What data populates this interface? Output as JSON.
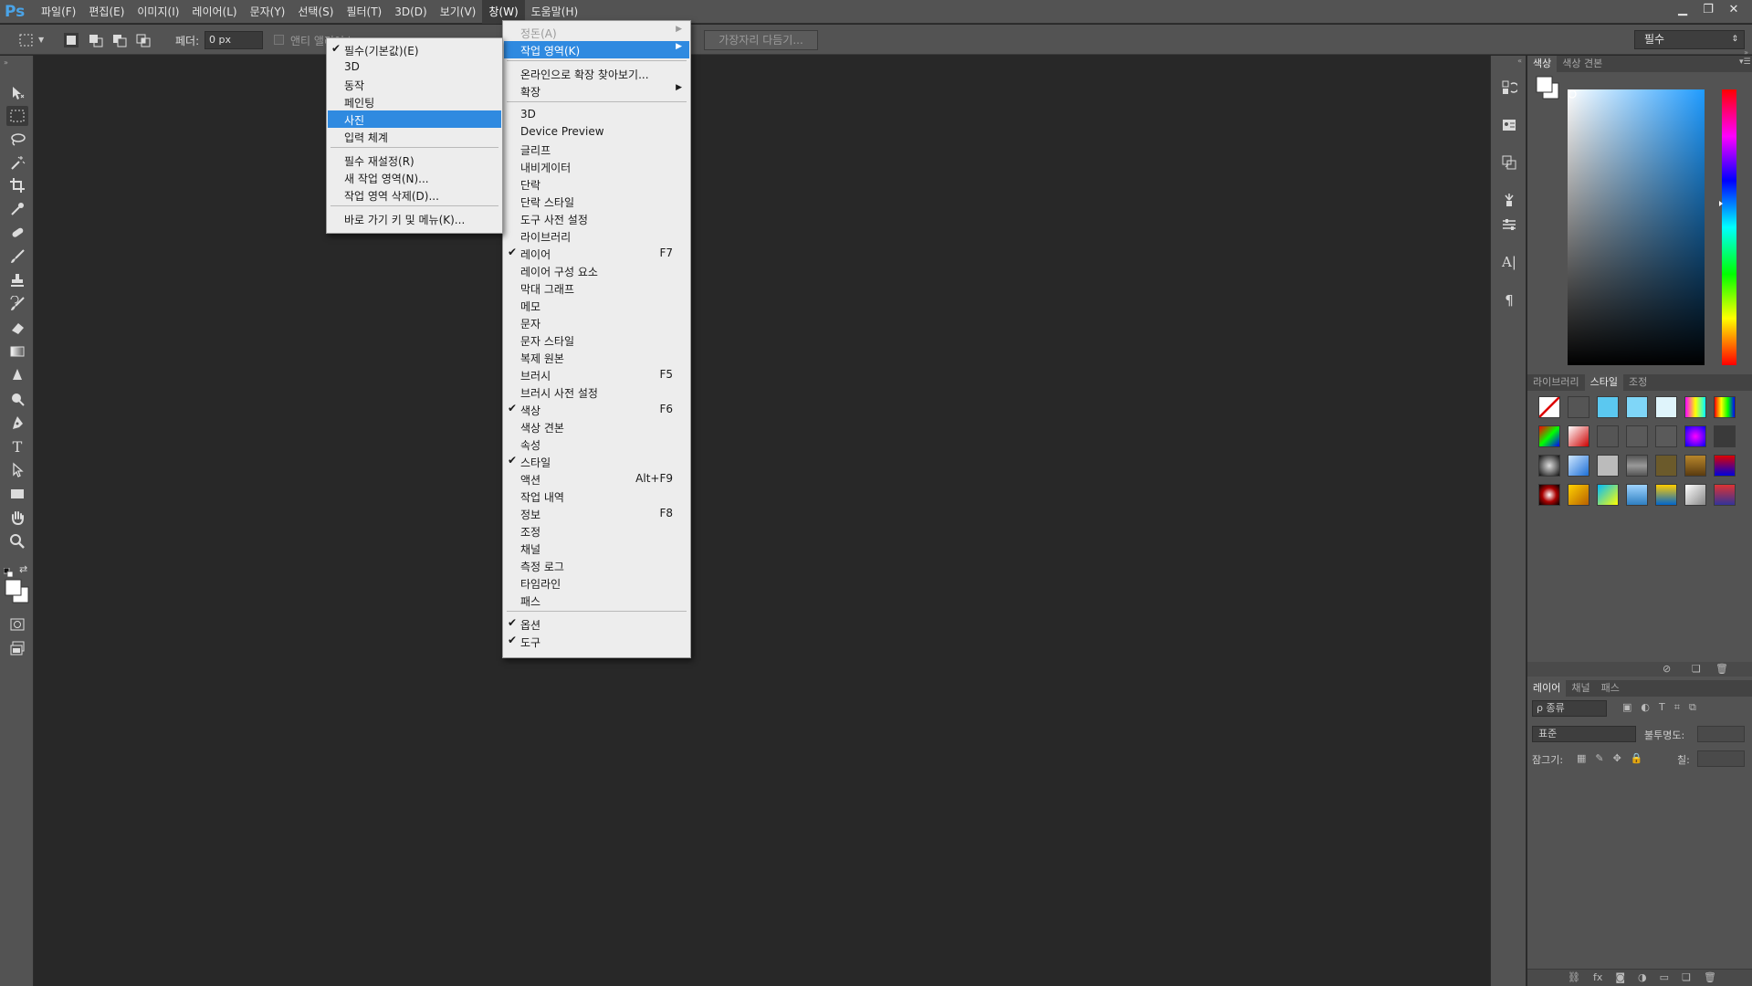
{
  "app": {
    "logo": "Ps"
  },
  "menubar": {
    "items": [
      "파일(F)",
      "편집(E)",
      "이미지(I)",
      "레이어(L)",
      "문자(Y)",
      "선택(S)",
      "필터(T)",
      "3D(D)",
      "보기(V)",
      "창(W)",
      "도움말(H)"
    ],
    "active": "창(W)"
  },
  "window_controls": {
    "minimize": "▁",
    "restore": "❐",
    "close": "✕"
  },
  "options": {
    "feather_label": "페더:",
    "feather_value": "0 px",
    "antialias_label": "앤티 앨리어스",
    "refine_edge": "가장자리 다듬기...",
    "workspace": "필수"
  },
  "workspace_submenu": {
    "items": [
      {
        "label": "필수(기본값)(E)",
        "checked": true
      },
      {
        "label": "3D"
      },
      {
        "label": "동작"
      },
      {
        "label": "페인팅"
      },
      {
        "label": "사진",
        "highlighted": true
      },
      {
        "label": "입력 체계"
      },
      {
        "label": "필수 재설정(R)"
      },
      {
        "label": "새 작업 영역(N)..."
      },
      {
        "label": "작업 영역 삭제(D)..."
      },
      {
        "label": "바로 가기 키 및 메뉴(K)..."
      }
    ]
  },
  "window_menu": {
    "items": [
      {
        "label": "정돈(A)",
        "arrow": true,
        "disabled": true
      },
      {
        "label": "작업 영역(K)",
        "arrow": true,
        "highlighted": true
      },
      {
        "label": "온라인으로 확장 찾아보기..."
      },
      {
        "label": "확장",
        "arrow": true
      },
      {
        "label": "3D"
      },
      {
        "label": "Device Preview"
      },
      {
        "label": "글리프"
      },
      {
        "label": "내비게이터"
      },
      {
        "label": "단락"
      },
      {
        "label": "단락 스타일"
      },
      {
        "label": "도구 사전 설정"
      },
      {
        "label": "라이브러리"
      },
      {
        "label": "레이어",
        "checked": true,
        "shortcut": "F7"
      },
      {
        "label": "레이어 구성 요소"
      },
      {
        "label": "막대 그래프"
      },
      {
        "label": "메모"
      },
      {
        "label": "문자"
      },
      {
        "label": "문자 스타일"
      },
      {
        "label": "복제 원본"
      },
      {
        "label": "브러시",
        "shortcut": "F5"
      },
      {
        "label": "브러시 사전 설정"
      },
      {
        "label": "색상",
        "checked": true,
        "shortcut": "F6"
      },
      {
        "label": "색상 견본"
      },
      {
        "label": "속성"
      },
      {
        "label": "스타일",
        "checked": true
      },
      {
        "label": "액션",
        "shortcut": "Alt+F9"
      },
      {
        "label": "작업 내역"
      },
      {
        "label": "정보",
        "shortcut": "F8"
      },
      {
        "label": "조정"
      },
      {
        "label": "채널"
      },
      {
        "label": "측정 로그"
      },
      {
        "label": "타임라인"
      },
      {
        "label": "패스"
      },
      {
        "label": "옵션",
        "checked": true
      },
      {
        "label": "도구",
        "checked": true
      }
    ]
  },
  "panels": {
    "color_tabs": [
      "색상",
      "색상 견본"
    ],
    "styles_tabs": [
      "라이브러리",
      "스타일",
      "조정"
    ],
    "layers_tabs": [
      "레이어",
      "채널",
      "패스"
    ],
    "layers": {
      "filter_kind": "ρ 종류",
      "blend_mode": "표준",
      "opacity_label": "불투명도:",
      "lock_label": "잠그기:",
      "fill_label": "칠:"
    }
  },
  "colors": {
    "accent": "#2f8ae0",
    "ui_bg": "#535353",
    "canvas_bg": "#282828"
  }
}
